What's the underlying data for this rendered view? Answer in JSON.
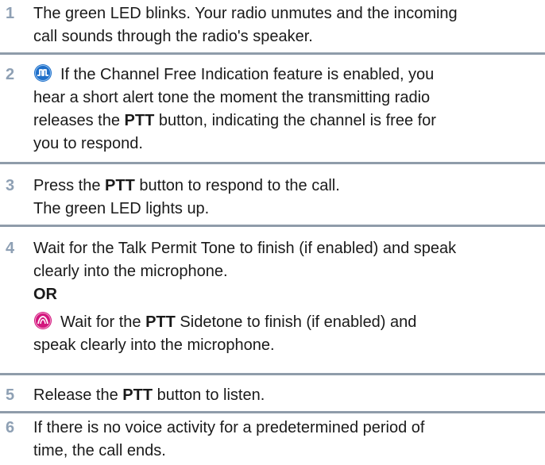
{
  "steps": [
    {
      "number": "1",
      "lines": [
        "The green LED blinks. Your radio unmutes and the incoming",
        "call sounds through the radio's speaker."
      ]
    },
    {
      "number": "2",
      "icon": "digital-mode-icon",
      "l1": "If the Channel Free Indication feature is enabled, you",
      "l2": "hear a short alert tone the moment the transmitting radio",
      "l3_pre": "releases the ",
      "l3_bold": "PTT",
      "l3_post": " button, indicating the channel is free for",
      "l4": "you to respond."
    },
    {
      "number": "3",
      "l1_pre": "Press the ",
      "l1_bold": "PTT",
      "l1_post": " button to respond to the call.",
      "l2": "The green LED lights up."
    },
    {
      "number": "4",
      "l1": "Wait for the Talk Permit Tone to finish (if enabled) and speak",
      "l2": "clearly into the microphone.",
      "or": "OR",
      "icon": "analog-mode-icon",
      "l3_pre": "Wait for the ",
      "l3_bold": "PTT",
      "l3_post": " Sidetone to finish (if enabled) and",
      "l4": "speak clearly into the microphone."
    },
    {
      "number": "5",
      "l1_pre": "Release the ",
      "l1_bold": "PTT",
      "l1_post": " button to listen."
    },
    {
      "number": "6",
      "lines": [
        "If there is no voice activity for a predetermined period of",
        "time, the call ends."
      ]
    }
  ],
  "colors": {
    "step_number": "#8ea0b4",
    "divider": "#8f9caa",
    "digital_icon": "#1f6fc9",
    "analog_icon": "#d2157d"
  }
}
